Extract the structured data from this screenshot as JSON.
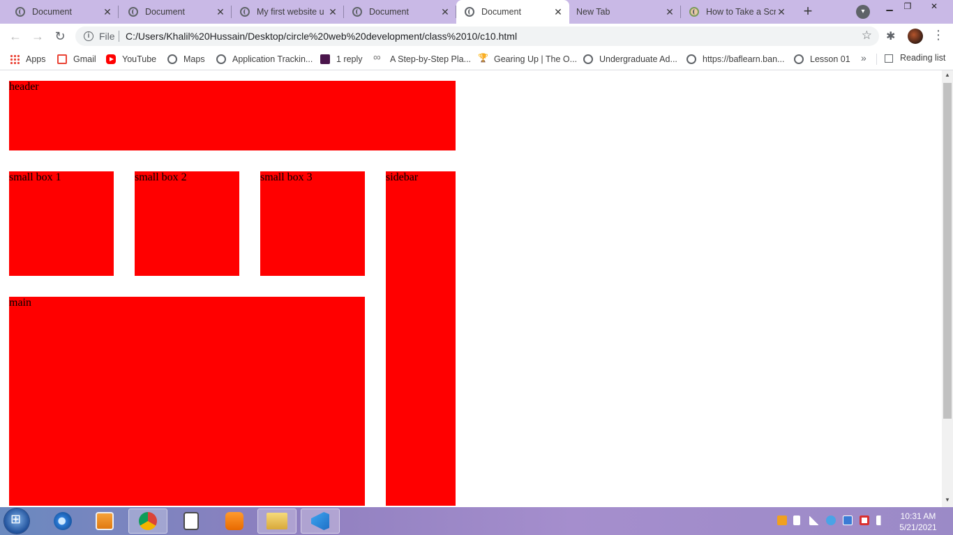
{
  "tabs": [
    {
      "title": "Document",
      "active": false
    },
    {
      "title": "Document",
      "active": false
    },
    {
      "title": "My first website u",
      "active": false
    },
    {
      "title": "Document",
      "active": false
    },
    {
      "title": "Document",
      "active": true
    },
    {
      "title": "New Tab",
      "active": false
    },
    {
      "title": "How to Take a Scr",
      "active": false
    }
  ],
  "new_tab_label": "+",
  "omnibox": {
    "scheme": "File",
    "url": "C:/Users/Khalil%20Hussain/Desktop/circle%20web%20development/class%2010/c10.html"
  },
  "bookmarks": [
    {
      "label": "Apps",
      "icon": "apps-icon"
    },
    {
      "label": "Gmail",
      "icon": "gmail-icon"
    },
    {
      "label": "YouTube",
      "icon": "youtube-icon"
    },
    {
      "label": "Maps",
      "icon": "globe-icon"
    },
    {
      "label": "Application Trackin...",
      "icon": "globe-icon"
    },
    {
      "label": "1 reply",
      "icon": "slack-icon"
    },
    {
      "label": "A Step-by-Step Pla...",
      "icon": "link-icon"
    },
    {
      "label": "Gearing Up | The O...",
      "icon": "trophy-icon"
    },
    {
      "label": "Undergraduate Ad...",
      "icon": "globe-icon"
    },
    {
      "label": "https://baflearn.ban...",
      "icon": "globe-icon"
    },
    {
      "label": "Lesson 01",
      "icon": "globe-icon"
    }
  ],
  "bookmarks_more": "»",
  "reading_list": "Reading list",
  "page": {
    "header": "header",
    "small_box_1": "small box 1",
    "small_box_2": "small box 2",
    "small_box_3": "small box 3",
    "sidebar": "sidebar",
    "main": "main",
    "box_color": "#ff0000"
  },
  "taskbar": {
    "time": "10:31 AM",
    "date": "5/21/2021",
    "apps": [
      "internet-explorer-icon",
      "media-player-icon",
      "chrome-icon",
      "notepad-icon",
      "pdf-icon",
      "file-explorer-icon",
      "vscode-icon"
    ]
  }
}
